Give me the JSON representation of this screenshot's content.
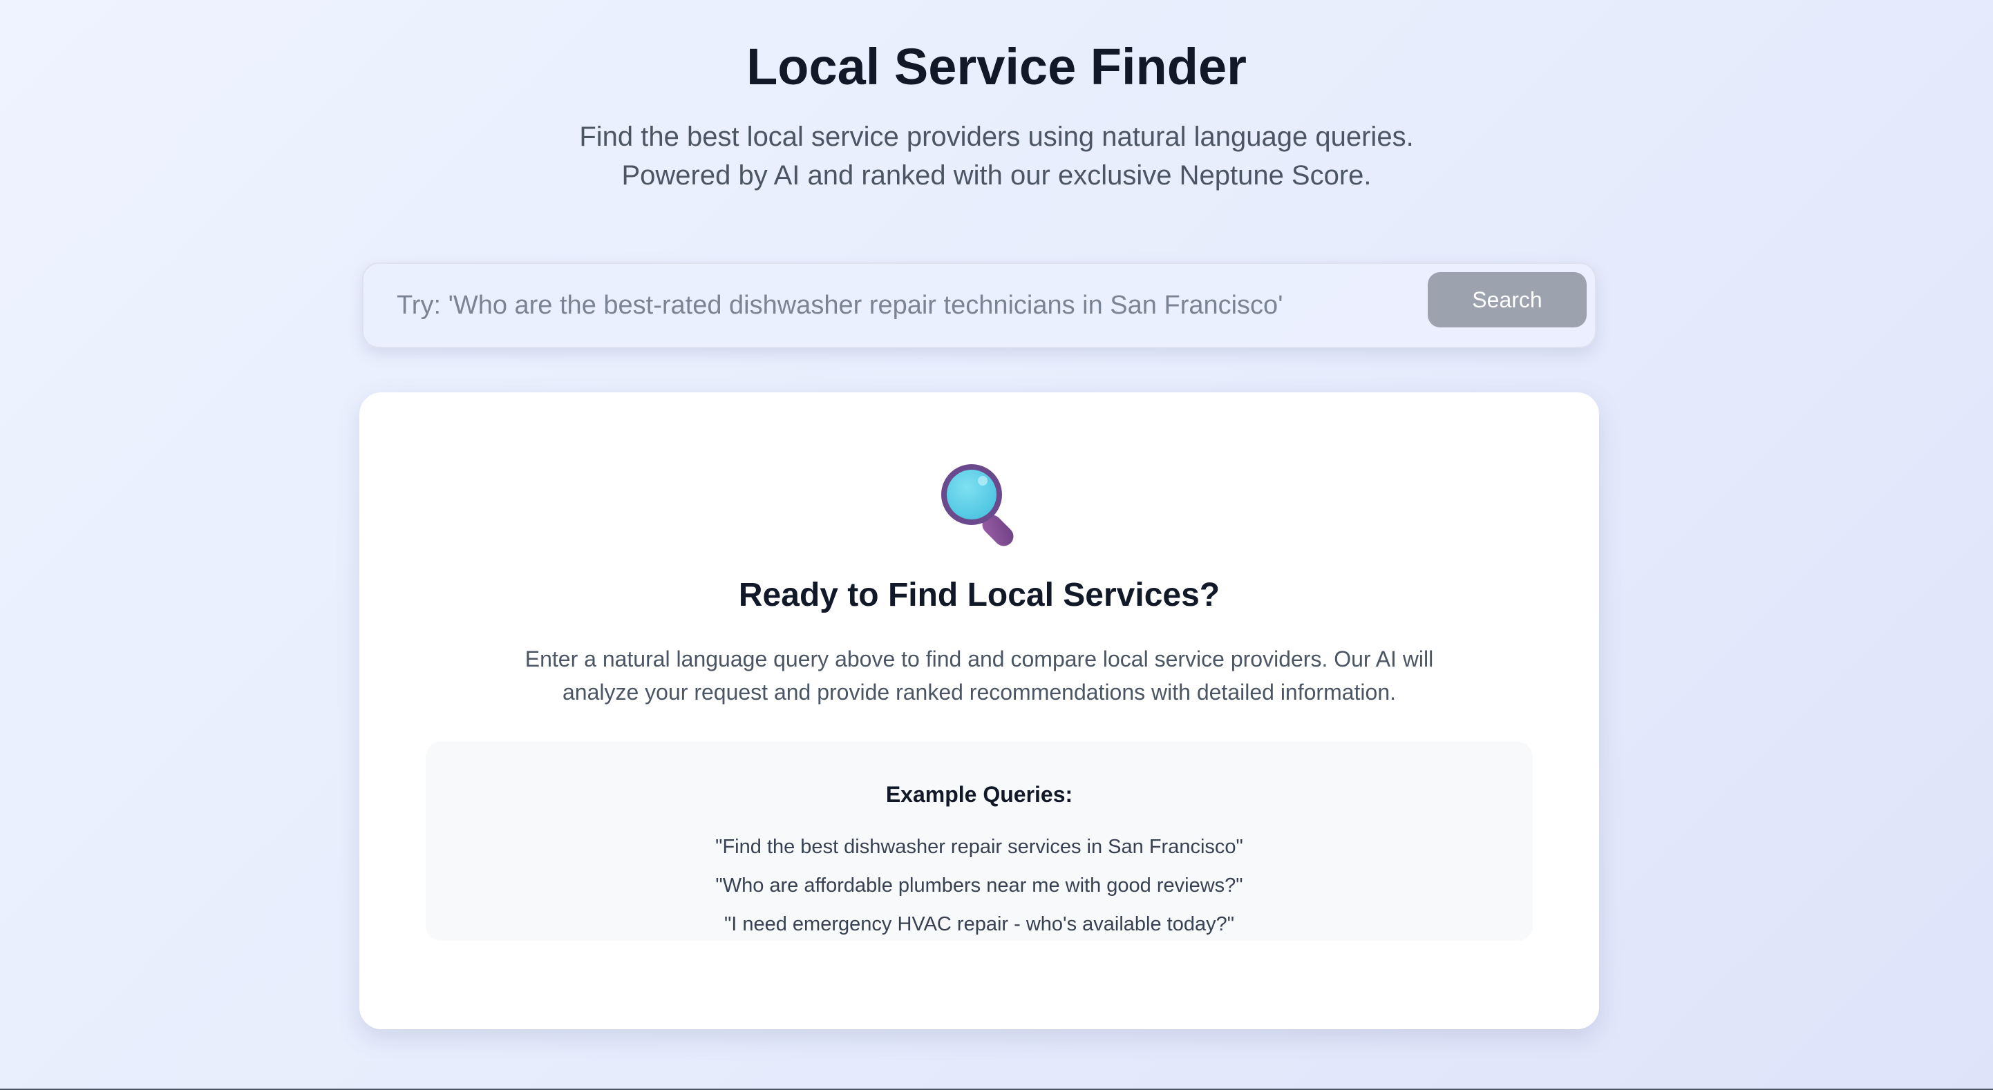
{
  "header": {
    "title": "Local Service Finder",
    "subtitle_line1": "Find the best local service providers using natural language queries.",
    "subtitle_line2": "Powered by AI and ranked with our exclusive Neptune Score."
  },
  "search": {
    "placeholder": "Try: 'Who are the best-rated dishwasher repair technicians in San Francisco'",
    "value": "",
    "button_label": "Search"
  },
  "empty_state": {
    "icon": "magnifying-glass-icon",
    "title": "Ready to Find Local Services?",
    "description": "Enter a natural language query above to find and compare local service providers. Our AI will analyze your request and provide ranked recommendations with detailed information.",
    "examples_title": "Example Queries:",
    "examples": [
      "\"Find the best dishwasher repair services in San Francisco\"",
      "\"Who are affordable plumbers near me with good reviews?\"",
      "\"I need emergency HVAC repair - who's available today?\""
    ]
  },
  "colors": {
    "search_button_bg": "#9ca3af",
    "title_text": "#111827",
    "body_text": "#4b5563",
    "magnifier_lens": "#5ccfe6",
    "magnifier_frame": "#7b4a8e"
  }
}
